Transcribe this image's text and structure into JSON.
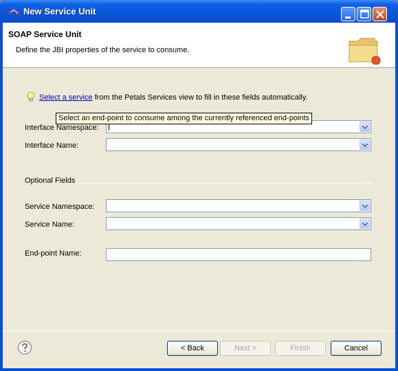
{
  "window": {
    "title": "New Service Unit"
  },
  "banner": {
    "title": "SOAP Service Unit",
    "description": "Define the JBI properties of the service to consume."
  },
  "hint": {
    "link_text": "Select a service",
    "rest_text": " from the Petals Services view to fill in these fields automatically."
  },
  "tooltip": {
    "text": "Select an end-point to consume among the currently referenced end-points"
  },
  "fields": {
    "interface_namespace": {
      "label": "Interface Namespace:",
      "value": ""
    },
    "interface_name": {
      "label": "Interface Name:",
      "value": ""
    },
    "optional_group": "Optional Fields",
    "service_namespace": {
      "label": "Service Namespace:",
      "value": ""
    },
    "service_name": {
      "label": "Service Name:",
      "value": ""
    },
    "endpoint_name": {
      "label": "End-point Name:",
      "value": ""
    }
  },
  "buttons": {
    "back": "< Back",
    "next": "Next >",
    "finish": "Finish",
    "cancel": "Cancel"
  },
  "colors": {
    "titlebar": "#0a55d8",
    "client_bg": "#ece9d8",
    "link": "#0000c0"
  },
  "icons": {
    "app": "petals-wizard-icon",
    "banner": "folder-icon",
    "hint": "lightbulb-icon",
    "help": "help-icon"
  }
}
